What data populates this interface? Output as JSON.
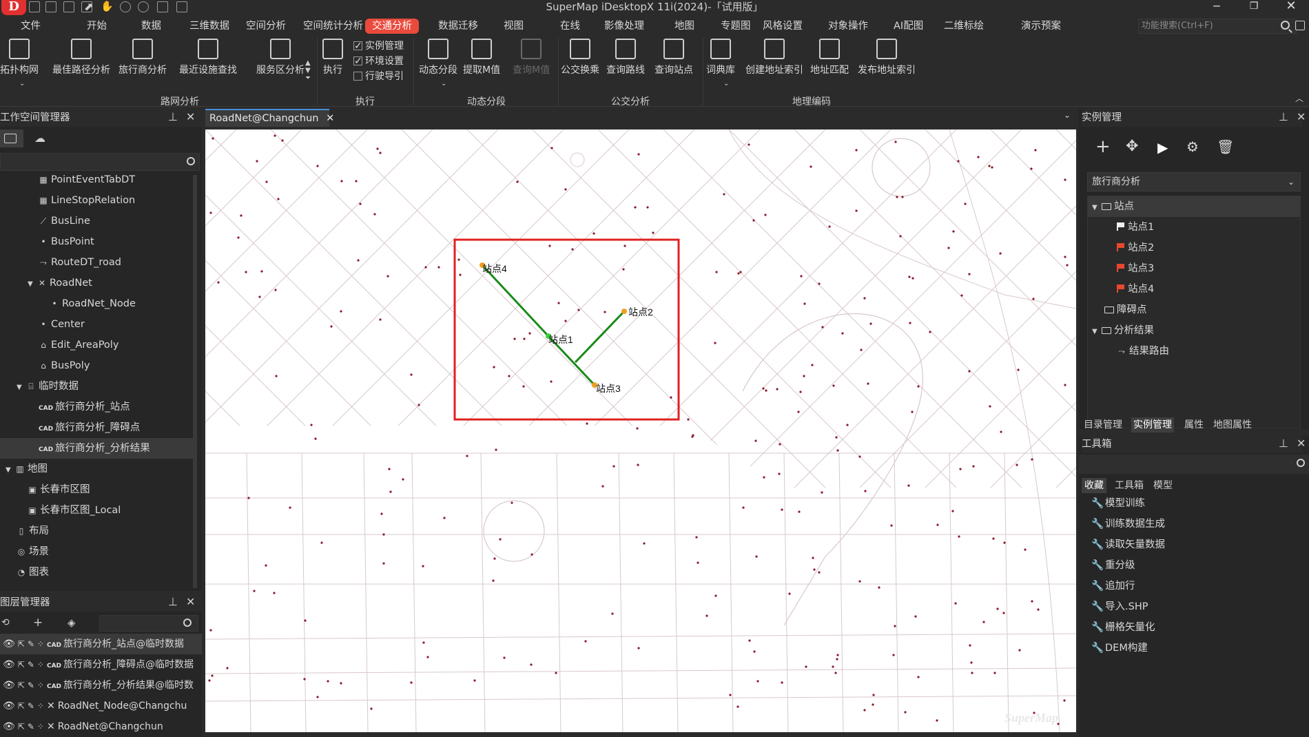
{
  "app": {
    "title": "SuperMap iDesktopX 11i(2024)-「试用版」",
    "logo": "D"
  },
  "menu": [
    {
      "label": "文件",
      "active": false
    },
    {
      "label": "开始",
      "active": false
    },
    {
      "label": "数据",
      "active": false
    },
    {
      "label": "三维数据",
      "active": false
    },
    {
      "label": "空间分析",
      "active": false
    },
    {
      "label": "空间统计分析",
      "active": false
    },
    {
      "label": "交通分析",
      "active": true
    },
    {
      "label": "数据迁移",
      "active": false
    },
    {
      "label": "视图",
      "active": false
    },
    {
      "label": "在线",
      "active": false
    },
    {
      "label": "影像处理",
      "active": false
    },
    {
      "label": "地图",
      "active": false
    },
    {
      "label": "专题图",
      "active": false
    },
    {
      "label": "风格设置",
      "active": false
    },
    {
      "label": "对象操作",
      "active": false
    },
    {
      "label": "AI配图",
      "active": false
    },
    {
      "label": "二维标绘",
      "active": false
    },
    {
      "label": "演示预案",
      "active": false
    }
  ],
  "search": {
    "placeholder": "功能搜索(Ctrl+F)"
  },
  "ribbon": {
    "buttons": [
      {
        "label": "拓扑构网",
        "icon": "topology-icon",
        "disabled": false
      },
      {
        "label": "最佳路径分析",
        "icon": "best-path-icon",
        "disabled": false
      },
      {
        "label": "旅行商分析",
        "icon": "tsp-icon",
        "disabled": false
      },
      {
        "label": "最近设施查找",
        "icon": "closest-facility-icon",
        "disabled": false
      },
      {
        "label": "服务区分析",
        "icon": "service-area-icon",
        "disabled": false
      },
      {
        "label": "执行",
        "icon": "execute-icon",
        "disabled": false
      },
      {
        "label": "动态分段",
        "icon": "dynamic-segment-icon",
        "disabled": false
      },
      {
        "label": "提取M值",
        "icon": "extract-m-icon",
        "disabled": false
      },
      {
        "label": "查询M值",
        "icon": "query-m-icon",
        "disabled": true
      },
      {
        "label": "公交换乘",
        "icon": "bus-transfer-icon",
        "disabled": false
      },
      {
        "label": "查询路线",
        "icon": "query-route-icon",
        "disabled": false
      },
      {
        "label": "查询站点",
        "icon": "query-stop-icon",
        "disabled": false
      },
      {
        "label": "词典库",
        "icon": "dictionary-icon",
        "disabled": false
      },
      {
        "label": "创建地址索引",
        "icon": "address-index-icon",
        "disabled": false
      },
      {
        "label": "地址匹配",
        "icon": "address-match-icon",
        "disabled": false
      },
      {
        "label": "发布地址索引",
        "icon": "publish-index-icon",
        "disabled": false
      }
    ],
    "checks": [
      {
        "label": "实例管理",
        "checked": true
      },
      {
        "label": "环境设置",
        "checked": true
      },
      {
        "label": "行驶导引",
        "checked": false
      }
    ],
    "groups": [
      "路网分析",
      "执行",
      "动态分段",
      "公交分析",
      "地理编码"
    ]
  },
  "workspace": {
    "title": "工作空间管理器",
    "items": [
      {
        "label": "PointEventTabDT",
        "icon": "table-icon",
        "indent": 3,
        "tri": ""
      },
      {
        "label": "LineStopRelation",
        "icon": "table-icon",
        "indent": 3,
        "tri": ""
      },
      {
        "label": "BusLine",
        "icon": "line-icon",
        "indent": 3,
        "tri": ""
      },
      {
        "label": "BusPoint",
        "icon": "point-icon",
        "indent": 3,
        "tri": ""
      },
      {
        "label": "RouteDT_road",
        "icon": "route-icon",
        "indent": 3,
        "tri": ""
      },
      {
        "label": "RoadNet",
        "icon": "network-icon",
        "indent": 2,
        "tri": "▼"
      },
      {
        "label": "RoadNet_Node",
        "icon": "point-icon",
        "indent": 4,
        "tri": ""
      },
      {
        "label": "Center",
        "icon": "point-icon",
        "indent": 3,
        "tri": ""
      },
      {
        "label": "Edit_AreaPoly",
        "icon": "region-icon",
        "indent": 3,
        "tri": ""
      },
      {
        "label": "BusPoly",
        "icon": "region-icon",
        "indent": 3,
        "tri": ""
      },
      {
        "label": "临时数据",
        "icon": "datasource-icon",
        "indent": 1,
        "tri": "▼"
      },
      {
        "label": "旅行商分析_站点",
        "icon": "cad-icon",
        "indent": 3,
        "tri": "",
        "cad": "CAD"
      },
      {
        "label": "旅行商分析_障碍点",
        "icon": "cad-icon",
        "indent": 3,
        "tri": "",
        "cad": "CAD"
      },
      {
        "label": "旅行商分析_分析结果",
        "icon": "cad-icon",
        "indent": 3,
        "tri": "",
        "cad": "CAD",
        "selected": true
      },
      {
        "label": "地图",
        "icon": "map-icon",
        "indent": 0,
        "tri": "▼"
      },
      {
        "label": "长春市区图",
        "icon": "map-doc-icon",
        "indent": 2,
        "tri": ""
      },
      {
        "label": "长春市区图_Local",
        "icon": "map-doc-icon",
        "indent": 2,
        "tri": ""
      },
      {
        "label": "布局",
        "icon": "layout-icon",
        "indent": 1,
        "tri": ""
      },
      {
        "label": "场景",
        "icon": "scene-icon",
        "indent": 1,
        "tri": ""
      },
      {
        "label": "图表",
        "icon": "chart-icon",
        "indent": 1,
        "tri": ""
      }
    ]
  },
  "layers": {
    "title": "图层管理器",
    "items": [
      {
        "label": "旅行商分析_站点@临时数据",
        "cad": "CAD",
        "selected": true
      },
      {
        "label": "旅行商分析_障碍点@临时数据",
        "cad": "CAD",
        "selected": false
      },
      {
        "label": "旅行商分析_分析结果@临时数",
        "cad": "CAD",
        "selected": false
      },
      {
        "label": "RoadNet_Node@Changchu",
        "cad": "",
        "selected": false
      },
      {
        "label": "RoadNet@Changchun",
        "cad": "",
        "selected": false
      }
    ]
  },
  "map": {
    "tab": "RoadNet@Changchun",
    "stops": [
      {
        "label": "站点1"
      },
      {
        "label": "站点2"
      },
      {
        "label": "站点3"
      },
      {
        "label": "站点4"
      }
    ],
    "colors": {
      "route": "#1a8a1a",
      "stop": "#f0a020",
      "highlight": "#e02020",
      "road": "#d8c8cc",
      "node": "#8a1a2a"
    },
    "watermark": "SuperMap"
  },
  "instance": {
    "title": "实例管理",
    "selected": "旅行商分析",
    "tree": [
      {
        "label": "站点",
        "kind": "folder",
        "indent": 0,
        "tri": "▼",
        "selected": true
      },
      {
        "label": "站点1",
        "kind": "flag-white",
        "indent": 2,
        "tri": ""
      },
      {
        "label": "站点2",
        "kind": "flag-red",
        "indent": 2,
        "tri": ""
      },
      {
        "label": "站点3",
        "kind": "flag-red",
        "indent": 2,
        "tri": ""
      },
      {
        "label": "站点4",
        "kind": "flag-red",
        "indent": 2,
        "tri": ""
      },
      {
        "label": "障碍点",
        "kind": "folder",
        "indent": 1,
        "tri": ""
      },
      {
        "label": "分析结果",
        "kind": "folder",
        "indent": 0,
        "tri": "▼"
      },
      {
        "label": "结果路由",
        "kind": "route",
        "indent": 2,
        "tri": ""
      }
    ]
  },
  "bottom_tabs": [
    {
      "label": "目录管理",
      "active": false
    },
    {
      "label": "实例管理",
      "active": true
    },
    {
      "label": "属性",
      "active": false
    },
    {
      "label": "地图属性",
      "active": false
    }
  ],
  "toolbox": {
    "title": "工具箱",
    "tabs": [
      {
        "label": "收藏",
        "active": true
      },
      {
        "label": "工具箱",
        "active": false
      },
      {
        "label": "模型",
        "active": false
      }
    ],
    "items": [
      "模型训练",
      "训练数据生成",
      "读取矢量数据",
      "重分级",
      "追加行",
      "导入.SHP",
      "栅格矢量化",
      "DEM构建"
    ]
  }
}
